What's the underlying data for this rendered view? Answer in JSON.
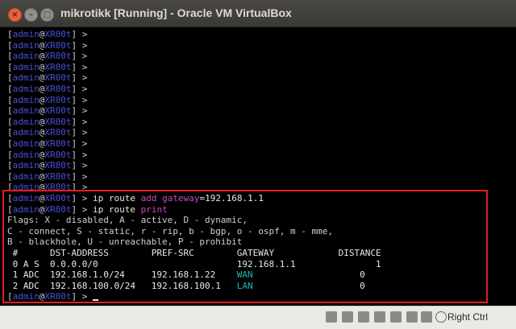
{
  "window": {
    "title": "mikrotikk [Running] - Oracle VM VirtualBox",
    "close_glyph": "×",
    "min_glyph": "–",
    "max_glyph": "□"
  },
  "terminal": {
    "prompt_open": "[",
    "prompt_user": "admin",
    "prompt_at": "@",
    "prompt_host": "XR00t",
    "prompt_close": "] > ",
    "empty_prompt_count": 15,
    "cmd1": {
      "ip": "ip",
      "route": "route",
      "add": "add",
      "gateway_key": "gateway",
      "gateway_val": "=192.168.1.1"
    },
    "cmd2": {
      "ip": "ip",
      "route": "route",
      "print": "print"
    },
    "flags": [
      "Flags: X - disabled, A - active, D - dynamic,",
      "C - connect, S - static, r - rip, b - bgp, o - ospf, m - mme,",
      "B - blackhole, U - unreachable, P - prohibit"
    ],
    "table_header": " #      DST-ADDRESS        PREF-SRC        GATEWAY            DISTANCE",
    "routes": [
      {
        "left": " 0 A S  0.0.0.0/0                          192.168.1.1",
        "gw_colored": "",
        "right": "               1"
      },
      {
        "left": " 1 ADC  192.168.1.0/24     192.168.1.22    ",
        "gw_colored": "WAN",
        "right": "                    0"
      },
      {
        "left": " 2 ADC  192.168.100.0/24   192.168.100.1   ",
        "gw_colored": "LAN",
        "right": "                    0"
      }
    ]
  },
  "statusbar": {
    "host_key": "Right Ctrl"
  }
}
